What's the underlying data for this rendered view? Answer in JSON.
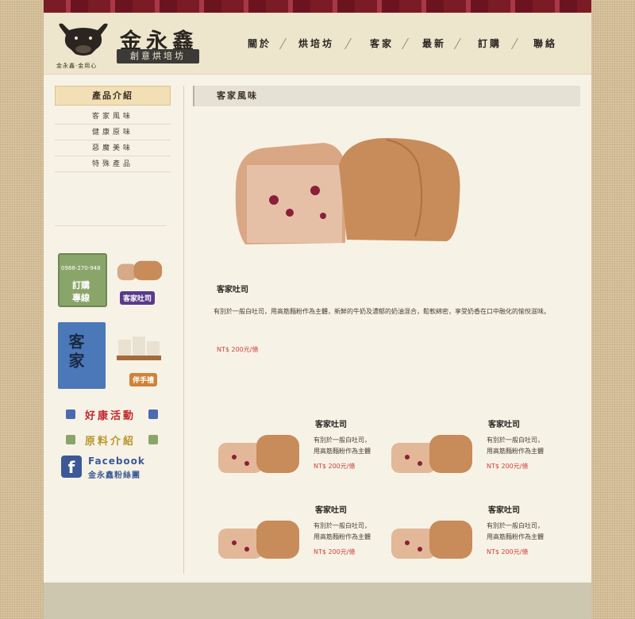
{
  "brand": {
    "logo_caption": "金永鑫·金用心",
    "name": "金永鑫",
    "tagline": "創意烘培坊"
  },
  "nav": {
    "items": [
      "關於",
      "烘培坊",
      "客家",
      "最新",
      "訂購",
      "聯絡"
    ]
  },
  "sidebar": {
    "title": "產品介紹",
    "items": [
      "客家風味",
      "健康原味",
      "惡魔美味",
      "特殊產品"
    ],
    "banners": {
      "order_line": {
        "phone": "0988-270-948",
        "text1": "訂購",
        "text2": "專線",
        "badge": "客家吐司"
      },
      "hakka": {
        "text": "客家",
        "badge": "伴手禮"
      },
      "promo": "好康活動",
      "ingredients": "原料介紹",
      "facebook": {
        "title": "Facebook",
        "sub": "金永鑫粉絲團"
      }
    }
  },
  "main": {
    "section_title": "客家風味",
    "featured": {
      "name": "客家吐司",
      "description": "有別於一般白吐司，用高筋麵粉作為主體，新鮮的牛奶及濃郁的奶油混合，鬆軟綿密，享受奶香在口中融化的愉悅滋味。",
      "price": "NT$ 200元/條"
    },
    "cards": [
      {
        "name": "客家吐司",
        "desc_line1": "有別於一般白吐司，",
        "desc_line2": "用高筋麵粉作為主體",
        "price": "NT$ 200元/條"
      },
      {
        "name": "客家吐司",
        "desc_line1": "有別於一般白吐司，",
        "desc_line2": "用高筋麵粉作為主體",
        "price": "NT$ 200元/條"
      },
      {
        "name": "客家吐司",
        "desc_line1": "有別於一般白吐司，",
        "desc_line2": "用高筋麵粉作為主體",
        "price": "NT$ 200元/條"
      },
      {
        "name": "客家吐司",
        "desc_line1": "有別於一般白吐司，",
        "desc_line2": "用高筋麵粉作為主體",
        "price": "NT$ 200元/條"
      }
    ]
  },
  "colors": {
    "accent_red": "#d0423a",
    "top_band": "#7a1b26",
    "sidebar_title_bg": "#f2dfb6"
  }
}
